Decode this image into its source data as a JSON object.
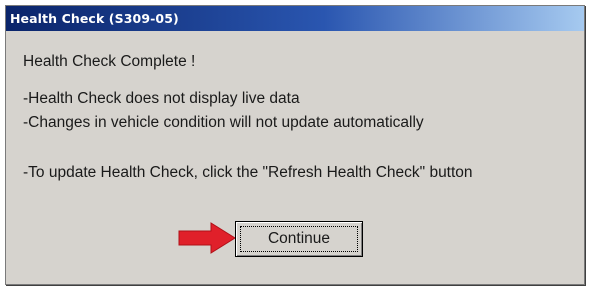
{
  "dialog": {
    "title": "Health Check (S309-05)",
    "heading": "Health Check Complete !",
    "notes": [
      "-Health Check does not display live data",
      "-Changes in vehicle condition will not update automatically",
      "-To update Health Check, click the \"Refresh Health Check\" button"
    ],
    "continue_label": "Continue"
  },
  "colors": {
    "title_gradient_start": "#0a246a",
    "title_gradient_end": "#a6caf0",
    "dialog_background": "#d6d3ce",
    "arrow": "#e0202a"
  },
  "icons": {
    "pointer_arrow": "red-right-arrow-icon"
  }
}
